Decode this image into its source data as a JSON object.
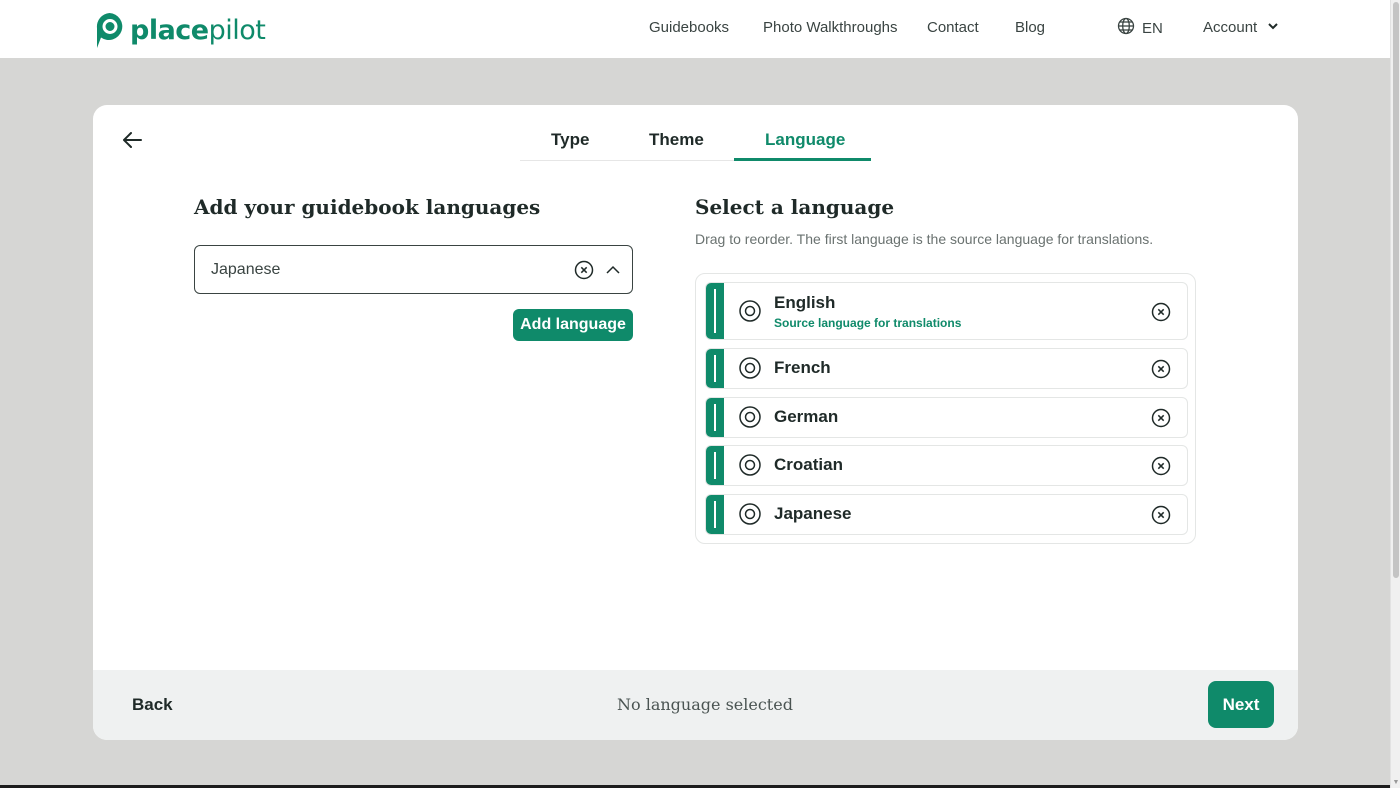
{
  "brand": {
    "name_part1": "place",
    "name_part2": "pilot",
    "color": "#0f8a6a"
  },
  "nav": {
    "links": [
      "Guidebooks",
      "Photo Walkthroughs",
      "Contact",
      "Blog"
    ],
    "language_code": "EN",
    "account_label": "Account"
  },
  "tabs": [
    {
      "label": "Type",
      "active": false
    },
    {
      "label": "Theme",
      "active": false
    },
    {
      "label": "Language",
      "active": true
    }
  ],
  "left": {
    "heading": "Add your guidebook languages",
    "select_value": "Japanese",
    "add_button": "Add language"
  },
  "right": {
    "heading": "Select a language",
    "subtext": "Drag to reorder. The first language is the source language for translations.",
    "languages": [
      {
        "name": "English",
        "note": "Source language for translations"
      },
      {
        "name": "French"
      },
      {
        "name": "German"
      },
      {
        "name": "Croatian"
      },
      {
        "name": "Japanese"
      }
    ]
  },
  "footer": {
    "back_label": "Back",
    "status": "No language selected",
    "next_label": "Next"
  }
}
